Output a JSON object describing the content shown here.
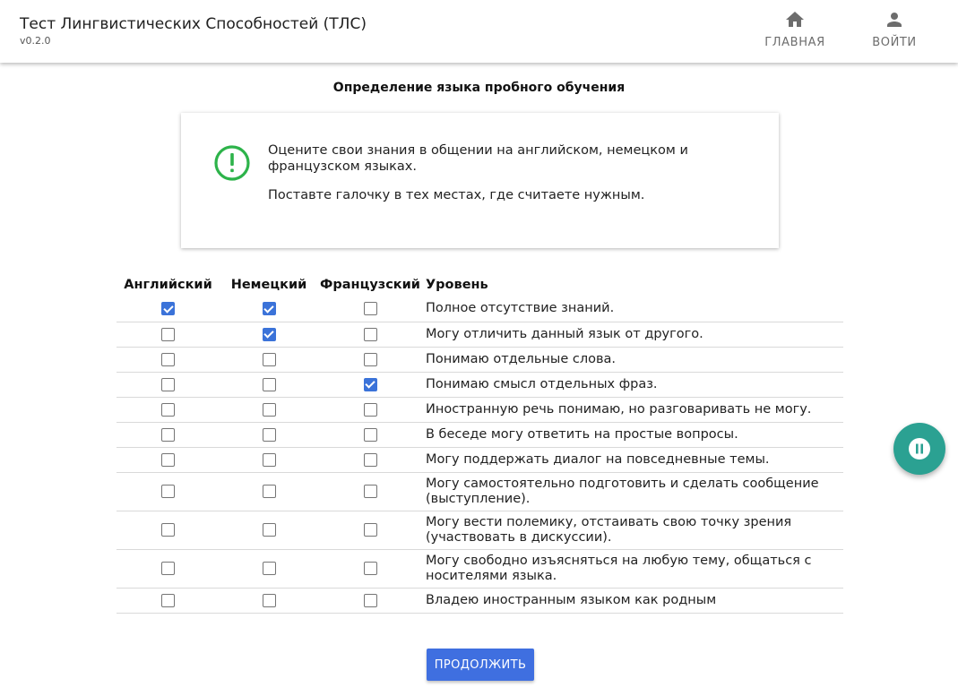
{
  "app": {
    "title": "Тест Лингвистических Способностей (ТЛС)",
    "version": "v0.2.0"
  },
  "nav": {
    "home_label": "ГЛАВНАЯ",
    "home_icon": "home-icon",
    "login_label": "ВОЙТИ",
    "login_icon": "person-icon"
  },
  "page": {
    "heading": "Определение языка пробного обучения"
  },
  "info": {
    "icon": "exclamation-circle-icon",
    "icon_color": "#2db34a",
    "line1": "Оцените свои знания в общении на английском, немецком и французском языках.",
    "line2": "Поставте галочку в тех местах, где считаете нужным."
  },
  "table": {
    "headers": [
      "Английский",
      "Немецкий",
      "Французский",
      "Уровень"
    ],
    "rows": [
      {
        "level": "Полное отсутствие знаний.",
        "en": true,
        "de": true,
        "fr": false
      },
      {
        "level": "Могу отличить данный язык от другого.",
        "en": false,
        "de": true,
        "fr": false
      },
      {
        "level": "Понимаю отдельные слова.",
        "en": false,
        "de": false,
        "fr": false
      },
      {
        "level": "Понимаю смысл отдельных фраз.",
        "en": false,
        "de": false,
        "fr": true
      },
      {
        "level": "Иностранную речь понимаю, но разговаривать не могу.",
        "en": false,
        "de": false,
        "fr": false
      },
      {
        "level": "В беседе могу ответить на простые вопросы.",
        "en": false,
        "de": false,
        "fr": false
      },
      {
        "level": "Могу поддержать диалог на повседневные темы.",
        "en": false,
        "de": false,
        "fr": false
      },
      {
        "level": "Могу самостоятельно подготовить и сделать сообщение (выступление).",
        "en": false,
        "de": false,
        "fr": false
      },
      {
        "level": "Могу вести полемику, отстаивать свою точку зрения (участвовать в дискуссии).",
        "en": false,
        "de": false,
        "fr": false
      },
      {
        "level": "Могу свободно изъясняться на любую тему, общаться с носителями языка.",
        "en": false,
        "de": false,
        "fr": false
      },
      {
        "level": "Владею иностранным языком как родным",
        "en": false,
        "de": false,
        "fr": false
      }
    ]
  },
  "actions": {
    "continue_label": "ПРОДОЛЖИТЬ",
    "pause_icon": "pause-icon",
    "accent_color": "#3f6fe0",
    "fab_color": "#2ba192"
  }
}
